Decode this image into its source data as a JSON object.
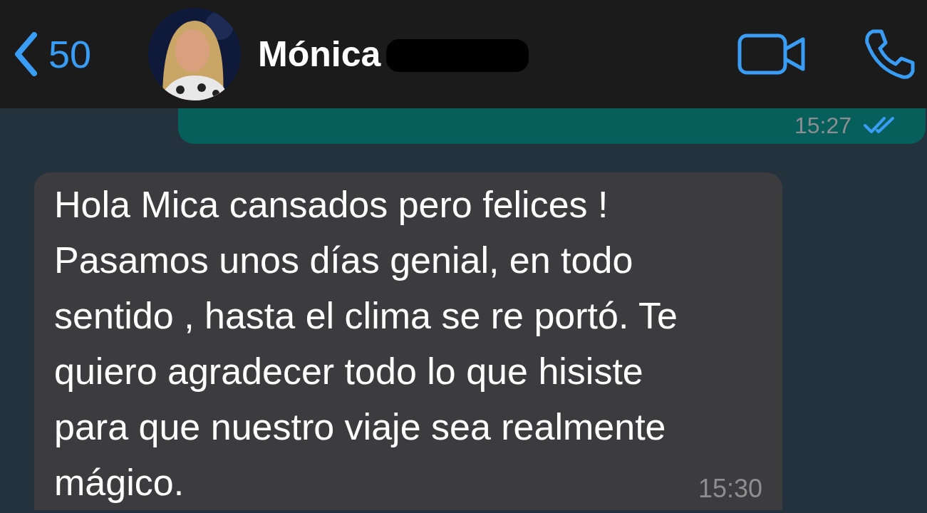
{
  "header": {
    "back_count": "50",
    "contact_name": "Mónica",
    "name_redacted": true
  },
  "messages": [
    {
      "kind": "outgoing",
      "time": "15:27",
      "read": true
    },
    {
      "kind": "incoming",
      "text": "Hola Mica cansados pero felices ! Pasamos unos días genial, en todo sentido , hasta el clima se re portó. Te quiero agradecer todo lo que hisiste para que nuestro viaje sea realmente mágico.",
      "time": "15:30"
    }
  ]
}
